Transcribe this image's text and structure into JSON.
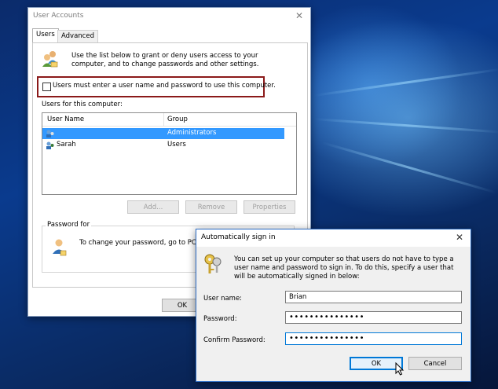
{
  "user_accounts": {
    "title": "User Accounts",
    "close_glyph": "✕",
    "tabs": [
      {
        "label": "Users"
      },
      {
        "label": "Advanced"
      }
    ],
    "intro": "Use the list below to grant or deny users access to your computer, and to change passwords and other settings.",
    "checkbox_label": "Users must enter a user name and password to use this computer.",
    "users_label": "Users for this computer:",
    "columns": {
      "user_name": "User Name",
      "group": "Group"
    },
    "rows": [
      {
        "name": "",
        "group": "Administrators",
        "selected": true
      },
      {
        "name": "Sarah",
        "group": "Users",
        "selected": false
      }
    ],
    "buttons": {
      "add": "Add...",
      "remove": "Remove",
      "properties": "Properties"
    },
    "password_group_label": "Password for",
    "password_text": "To change your password, go to PC",
    "ok": "OK"
  },
  "auto_signin": {
    "title": "Automatically sign in",
    "close_glyph": "✕",
    "description": "You can set up your computer so that users do not have to type a user name and password to sign in. To do this, specify a user that will be automatically signed in below:",
    "fields": {
      "username_label": "User name:",
      "username_value": "Brian",
      "password_label": "Password:",
      "password_value": "•••••••••••••••",
      "confirm_label": "Confirm Password:",
      "confirm_value": "•••••••••••••••"
    },
    "ok": "OK",
    "cancel": "Cancel"
  },
  "colors": {
    "accent": "#0078d7",
    "selection": "#3399ff",
    "highlight_border": "#8b1a1a"
  }
}
